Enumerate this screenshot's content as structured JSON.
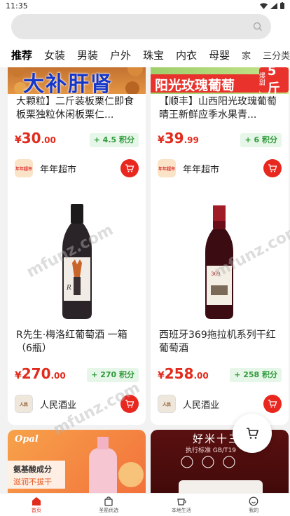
{
  "status_bar": {
    "time": "11:35"
  },
  "search": {
    "placeholder": ""
  },
  "categories": [
    "推荐",
    "女装",
    "男装",
    "户外",
    "珠宝",
    "内衣",
    "母婴",
    "家",
    "三分类"
  ],
  "products": [
    {
      "banner_text": "大补肝肾",
      "title": "大颗粒】二斤装板栗仁即食板栗独粒休闲板栗仁...",
      "price_currency": "¥",
      "price_int": "30",
      "price_dec": ".00",
      "points": "+ 4.5 积分",
      "shop_name": "年年超市",
      "shop_logo_text": "年年超市"
    },
    {
      "banner_text": "阳光玫瑰葡萄",
      "banner_badge_top": "爆甜",
      "banner_badge_bottom": "5斤",
      "title": "【顺丰】山西阳光玫瑰葡萄晴王新鲜应季水果青...",
      "price_currency": "¥",
      "price_int": "39",
      "price_dec": ".99",
      "points": "+ 6 积分",
      "shop_name": "年年超市",
      "shop_logo_text": "年年超市"
    },
    {
      "title": "R先生·梅洛红葡萄酒 一箱（6瓶）",
      "price_currency": "¥",
      "price_int": "270",
      "price_dec": ".00",
      "points": "+ 270 积分",
      "shop_name": "人民酒业",
      "shop_logo_text": "人民"
    },
    {
      "title": "西班牙369拖拉机系列干红葡萄酒",
      "price_currency": "¥",
      "price_int": "258",
      "price_dec": ".00",
      "points": "+ 258 积分",
      "shop_name": "人民酒业",
      "shop_logo_text": "人民"
    },
    {
      "banner_brand": "Opal",
      "banner_line1": "氨基酸成分",
      "banner_line2": "滋润不拔干"
    },
    {
      "banner_line1": "好米十三",
      "banner_line2": "执行标准 GB/T19"
    }
  ],
  "tabbar": [
    {
      "label": "首页"
    },
    {
      "label": "圣筋优选"
    },
    {
      "label": "本地生活"
    },
    {
      "label": "我的"
    }
  ],
  "watermark": "mfunz.com",
  "colors": {
    "accent": "#e12b1d",
    "points_bg": "#e6f6e8",
    "points_text": "#2f9a3a"
  }
}
